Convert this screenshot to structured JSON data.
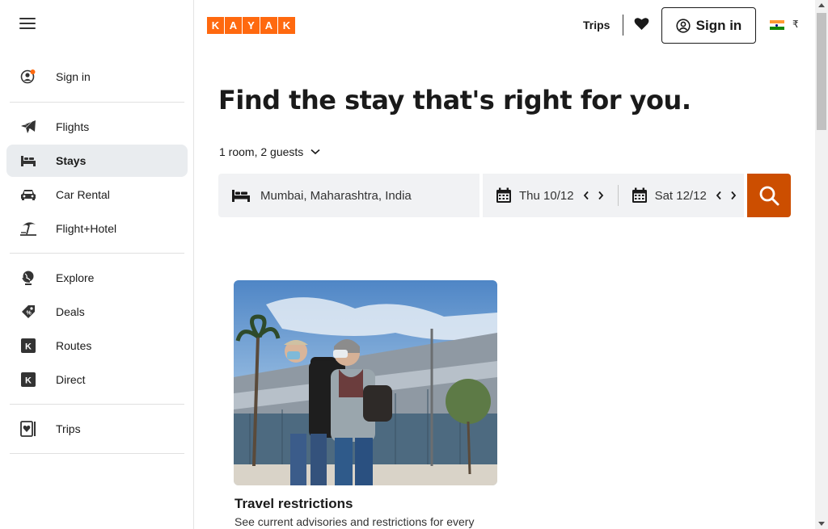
{
  "sidebar": {
    "menu_icon": "hamburger-icon",
    "items": [
      {
        "label": "Sign in",
        "icon": "user-circle-icon"
      },
      {
        "label": "Flights",
        "icon": "plane-icon"
      },
      {
        "label": "Stays",
        "icon": "bed-icon",
        "active": true
      },
      {
        "label": "Car Rental",
        "icon": "car-icon"
      },
      {
        "label": "Flight+Hotel",
        "icon": "beach-icon"
      },
      {
        "label": "Explore",
        "icon": "globe-icon"
      },
      {
        "label": "Deals",
        "icon": "tag-icon"
      },
      {
        "label": "Routes",
        "icon": "kayak-k-icon"
      },
      {
        "label": "Direct",
        "icon": "kayak-k-icon"
      },
      {
        "label": "Trips",
        "icon": "trips-heart-icon"
      }
    ]
  },
  "header": {
    "logo_letters": [
      "K",
      "A",
      "Y",
      "A",
      "K"
    ],
    "trips_label": "Trips",
    "signin_label": "Sign in",
    "currency": "₹"
  },
  "main": {
    "headline": "Find the stay that's right for you.",
    "guests_label": "1 room, 2 guests",
    "destination": "Mumbai, Maharashtra, India",
    "checkin": "Thu 10/12",
    "checkout": "Sat 12/12"
  },
  "card": {
    "title": "Travel restrictions",
    "description": "See current advisories and restrictions for every"
  },
  "colors": {
    "brand": "#ff690f",
    "search_button": "#cc4e00",
    "input_bg": "#f1f2f4",
    "active_nav_bg": "#e9ecef"
  }
}
